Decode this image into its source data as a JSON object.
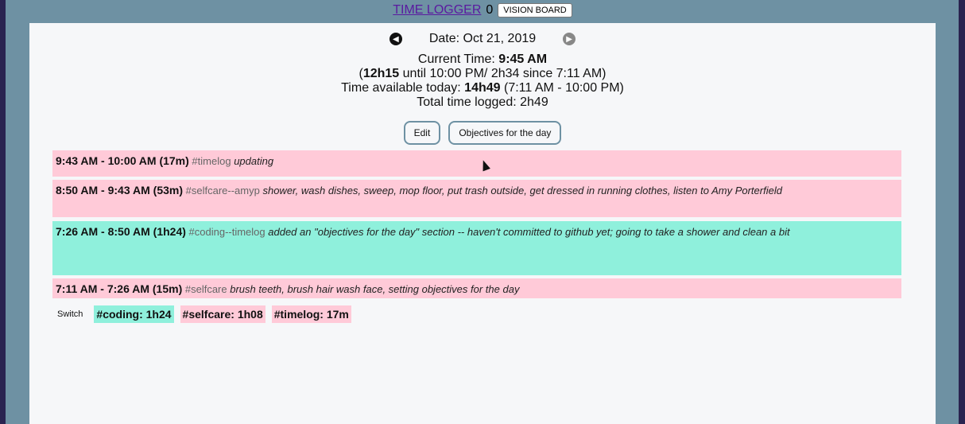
{
  "header": {
    "app_title": "TIME LOGGER",
    "counter": "0",
    "vision_board_label": "VISION BOARD"
  },
  "datebar": {
    "date_label": "Date: Oct 21, 2019",
    "prev_icon": "chevron-left-circle-icon",
    "next_icon": "chevron-right-circle-icon"
  },
  "info": {
    "current_time_label": "Current Time:",
    "current_time_value": "9:45 AM",
    "open_paren": "(",
    "remaining_bold": "12h15",
    "remaining_rest": " until 10:00 PM/ 2h34 since 7:11 AM)",
    "available_label": "Time available today:",
    "available_value": "14h49",
    "available_range": "(7:11 AM - 10:00 PM)",
    "total_logged": "Total time logged: 2h49"
  },
  "actions": {
    "edit_label": "Edit",
    "objectives_label": "Objectives for the day"
  },
  "entries": [
    {
      "time": "9:43 AM - 10:00 AM (17m)",
      "tag": "#timelog",
      "desc": "updating",
      "color": "#ffcad8"
    },
    {
      "time": "8:50 AM - 9:43 AM (53m)",
      "tag": "#selfcare--amyp",
      "desc": "shower, wash dishes, sweep, mop floor, put trash outside, get dressed in running clothes, listen to Amy Porterfield",
      "color": "#ffcad8"
    },
    {
      "time": "7:26 AM - 8:50 AM (1h24)",
      "tag": "#coding--timelog",
      "desc": "added an \"objectives for the day\" section -- haven't committed to github yet; going to take a shower and clean a bit",
      "color": "#8ff0dc"
    },
    {
      "time": "7:11 AM - 7:26 AM (15m)",
      "tag": "#selfcare",
      "desc": "brush teeth, brush hair wash face, setting objectives for the day",
      "color": "#ffcad8"
    }
  ],
  "summary": {
    "switch_label": "Switch",
    "chips": [
      {
        "label": "#coding: 1h24",
        "color": "#8ff0dc"
      },
      {
        "label": "#selfcare: 1h08",
        "color": "#ffcad8"
      },
      {
        "label": "#timelog: 17m",
        "color": "#ffcad8"
      }
    ]
  },
  "colors": {
    "page_background": "#6e91a3",
    "panel_background": "#f6f7f9",
    "accent_border": "#6e91a3"
  }
}
